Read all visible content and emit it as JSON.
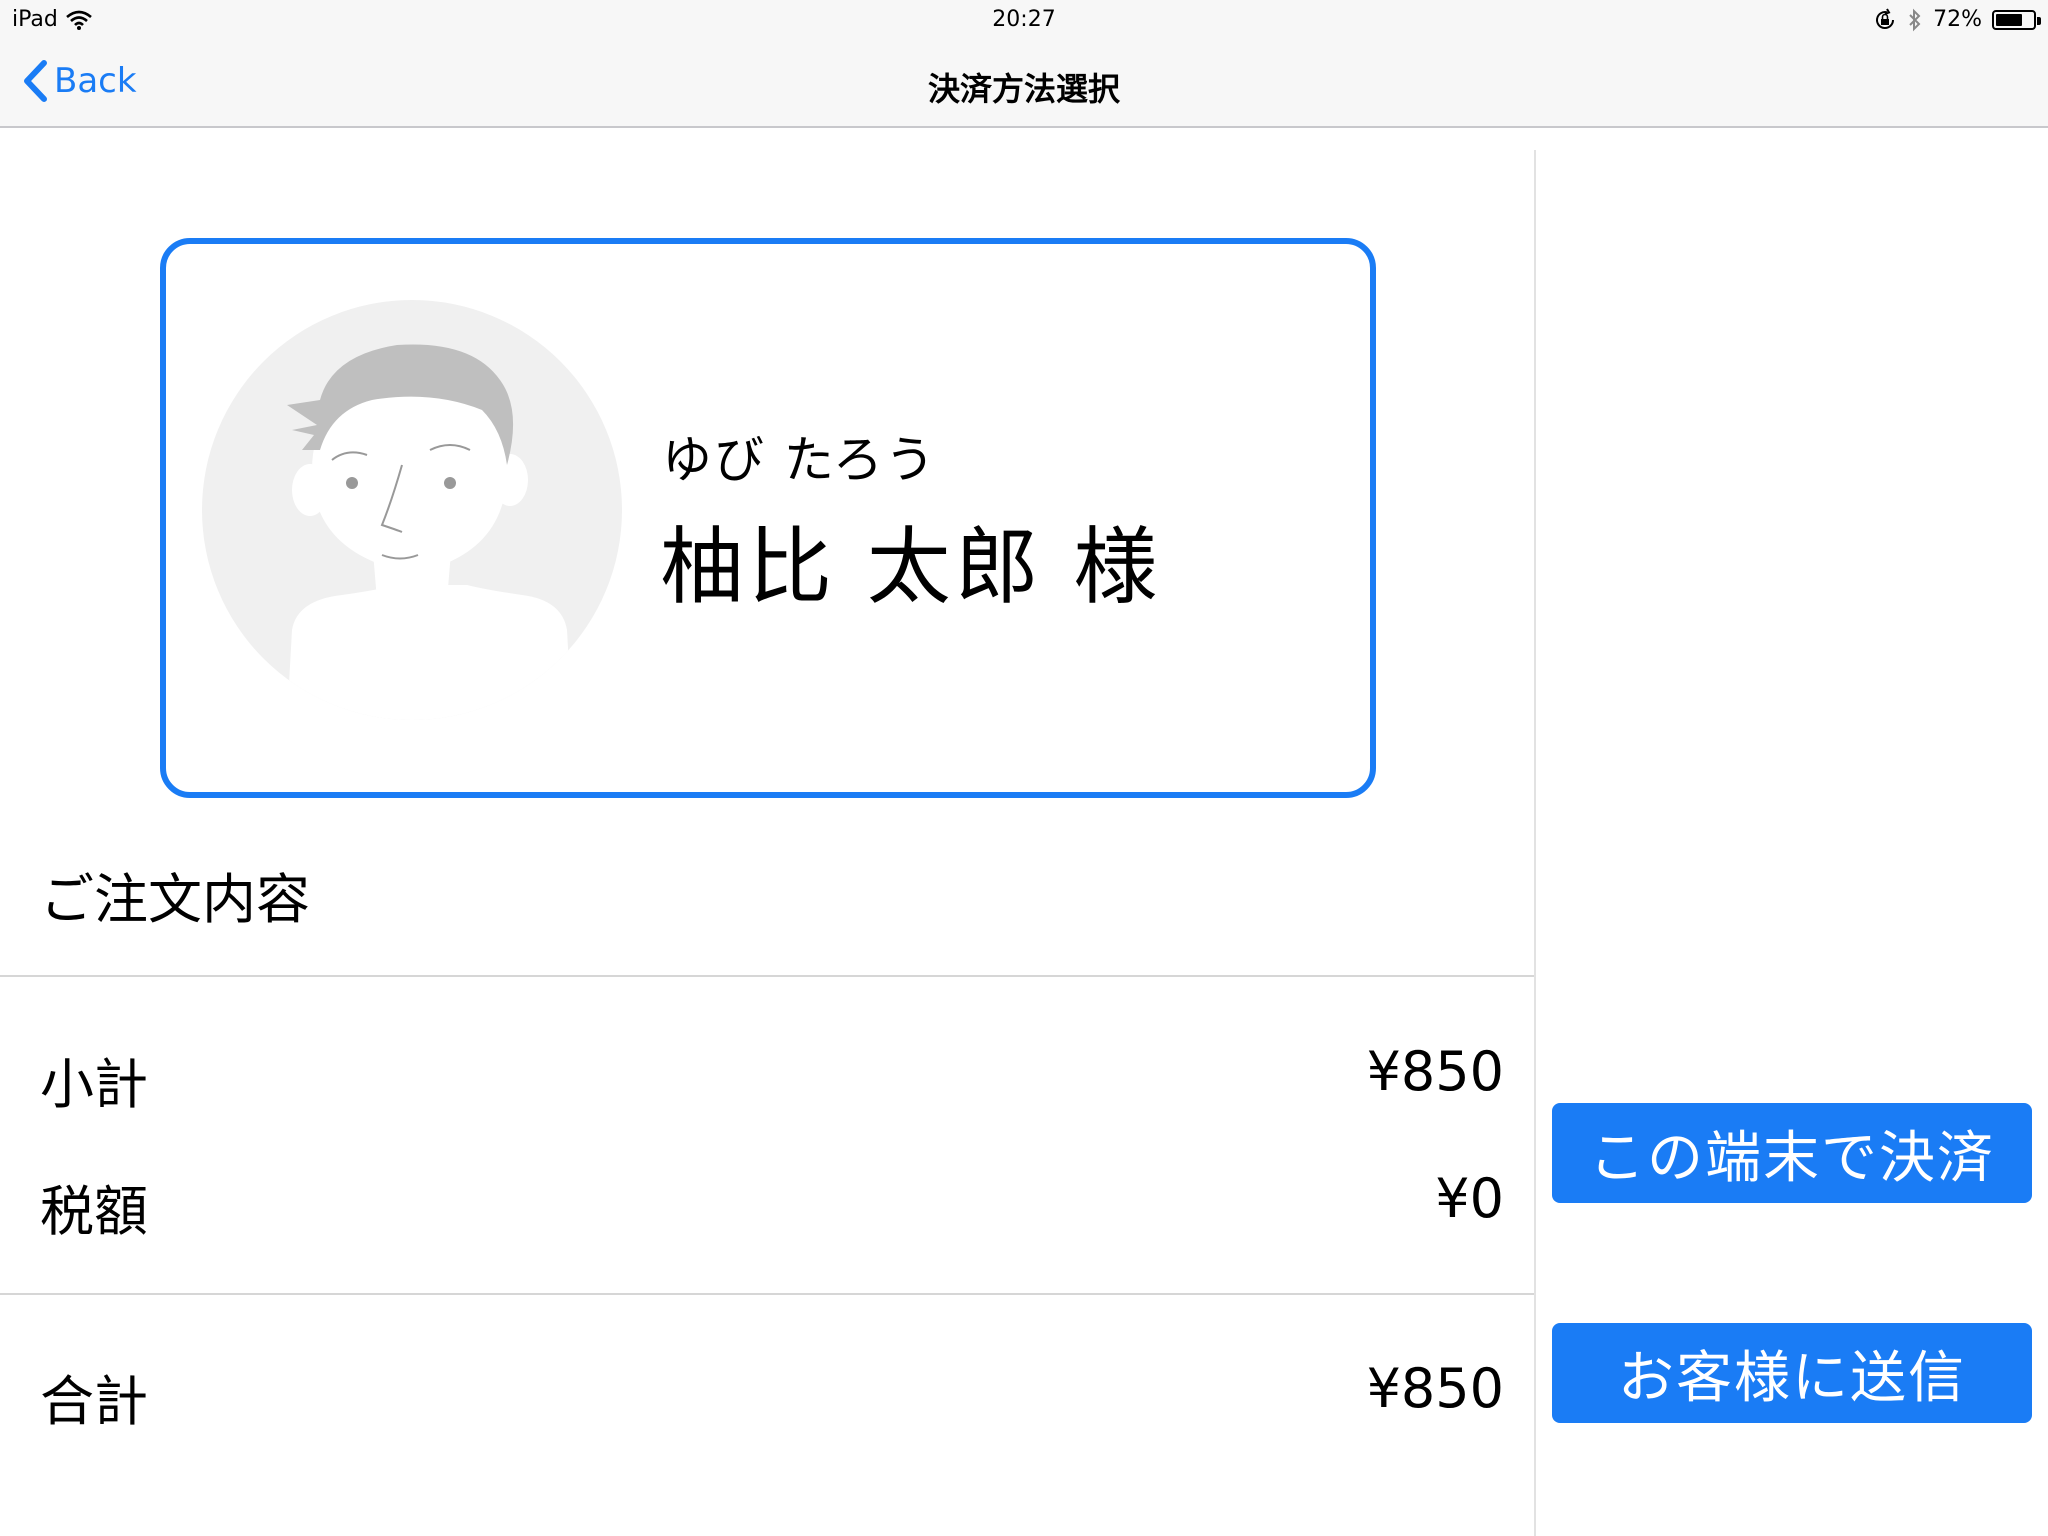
{
  "status_bar": {
    "device": "iPad",
    "time": "20:27",
    "battery": "72%",
    "battery_level": 0.72
  },
  "nav": {
    "back_label": "Back",
    "title": "決済方法選択"
  },
  "customer": {
    "furigana": "ゆび たろう",
    "name": "柚比 太郎 様"
  },
  "order": {
    "heading": "ご注文内容",
    "subtotal_label": "小計",
    "subtotal_value": "¥850",
    "tax_label": "税額",
    "tax_value": "¥0",
    "total_label": "合計",
    "total_value": "¥850"
  },
  "actions": {
    "pay_on_device": "この端末で決済",
    "send_to_customer": "お客様に送信"
  },
  "colors": {
    "accent": "#1a7cf5"
  }
}
